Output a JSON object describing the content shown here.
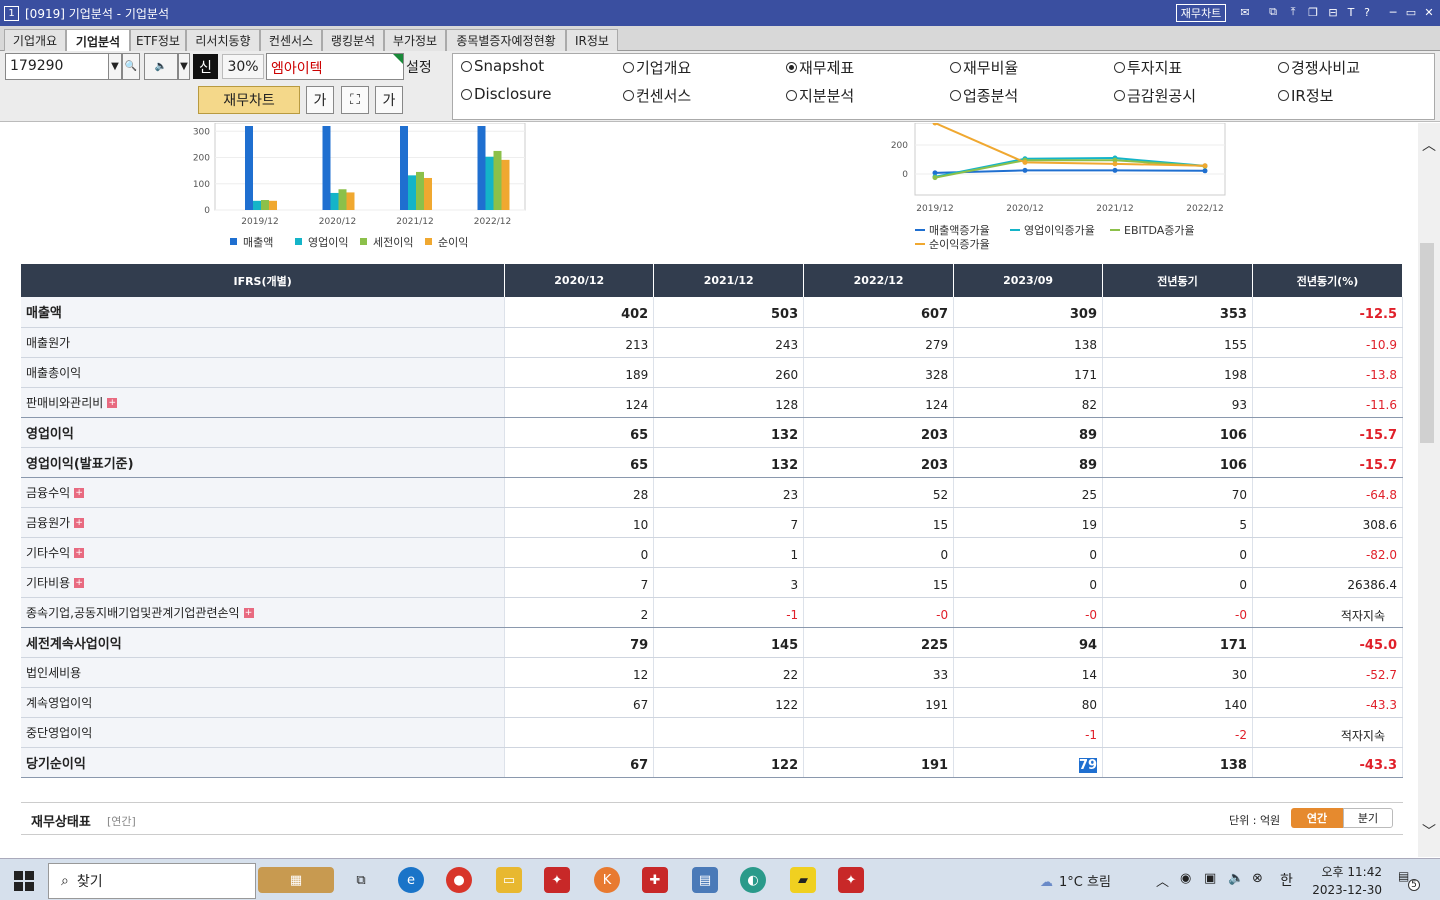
{
  "window": {
    "num": "1",
    "title": "[0919] 기업분석 - 기업분석",
    "fin_chart_btn": "재무차트"
  },
  "tabs": [
    "기업개요",
    "기업분석",
    "ETF정보",
    "리서치동향",
    "컨센서스",
    "랭킹분석",
    "부가정보",
    "종목별증자예정현황",
    "IR정보"
  ],
  "active_tab": "기업분석",
  "controls": {
    "code": "179290",
    "shin": "신",
    "percent": "30%",
    "company": "엠아이텍",
    "settings": "설정",
    "fin_chart": "재무차트",
    "font_btn": "가",
    "font_btn2": "가"
  },
  "radios": [
    {
      "label": "Snapshot",
      "checked": false
    },
    {
      "label": "기업개요",
      "checked": false
    },
    {
      "label": "재무제표",
      "checked": true
    },
    {
      "label": "재무비율",
      "checked": false
    },
    {
      "label": "투자지표",
      "checked": false
    },
    {
      "label": "경쟁사비교",
      "checked": false
    },
    {
      "label": "Disclosure",
      "checked": false
    },
    {
      "label": "컨센서스",
      "checked": false
    },
    {
      "label": "지분분석",
      "checked": false
    },
    {
      "label": "업종분석",
      "checked": false
    },
    {
      "label": "금감원공시",
      "checked": false
    },
    {
      "label": "IR정보",
      "checked": false
    }
  ],
  "chart_data": [
    {
      "type": "bar",
      "categories": [
        "2019/12",
        "2020/12",
        "2021/12",
        "2022/12"
      ],
      "ylim": [
        0,
        320
      ],
      "yticks": [
        "0",
        "100",
        "200",
        "300"
      ],
      "series": [
        {
          "name": "매출액",
          "color": "#1f6fd0",
          "values": [
            320,
            320,
            320,
            320
          ]
        },
        {
          "name": "영업이익",
          "color": "#14b4c8",
          "values": [
            35,
            65,
            132,
            203
          ]
        },
        {
          "name": "세전이익",
          "color": "#8cc04a",
          "values": [
            38,
            79,
            145,
            225
          ]
        },
        {
          "name": "순이익",
          "color": "#f0a830",
          "values": [
            35,
            67,
            122,
            191
          ]
        }
      ]
    },
    {
      "type": "line",
      "categories": [
        "2019/12",
        "2020/12",
        "2021/12",
        "2022/12"
      ],
      "yticks": [
        "0",
        "200"
      ],
      "series": [
        {
          "name": "매출액증가율",
          "color": "#1f6fd0",
          "values": [
            8,
            25,
            25,
            22
          ]
        },
        {
          "name": "영업이익증가율",
          "color": "#14b4c8",
          "values": [
            -20,
            105,
            110,
            56
          ]
        },
        {
          "name": "EBITDA증가율",
          "color": "#8cc04a",
          "values": [
            -25,
            95,
            95,
            54
          ]
        },
        {
          "name": "순이익증가율",
          "color": "#f0a830",
          "values": [
            520,
            80,
            70,
            57
          ]
        }
      ]
    }
  ],
  "table": {
    "headers": [
      "IFRS(개별)",
      "2020/12",
      "2021/12",
      "2022/12",
      "2023/09",
      "전년동기",
      "전년동기(%)"
    ],
    "rows": [
      {
        "label": "매출액",
        "vals": [
          "402",
          "503",
          "607",
          "309",
          "353",
          "-12.5"
        ],
        "bold": true,
        "plus": false
      },
      {
        "label": "매출원가",
        "vals": [
          "213",
          "243",
          "279",
          "138",
          "155",
          "-10.9"
        ],
        "bold": false,
        "plus": false
      },
      {
        "label": "매출총이익",
        "vals": [
          "189",
          "260",
          "328",
          "171",
          "198",
          "-13.8"
        ],
        "bold": false,
        "plus": false
      },
      {
        "label": "판매비와관리비",
        "vals": [
          "124",
          "128",
          "124",
          "82",
          "93",
          "-11.6"
        ],
        "bold": false,
        "plus": true
      },
      {
        "label": "영업이익",
        "vals": [
          "65",
          "132",
          "203",
          "89",
          "106",
          "-15.7"
        ],
        "bold": true,
        "plus": false
      },
      {
        "label": "영업이익(발표기준)",
        "vals": [
          "65",
          "132",
          "203",
          "89",
          "106",
          "-15.7"
        ],
        "bold": true,
        "plus": false
      },
      {
        "label": "금융수익",
        "vals": [
          "28",
          "23",
          "52",
          "25",
          "70",
          "-64.8"
        ],
        "bold": false,
        "plus": true
      },
      {
        "label": "금융원가",
        "vals": [
          "10",
          "7",
          "15",
          "19",
          "5",
          "308.6"
        ],
        "bold": false,
        "plus": true
      },
      {
        "label": "기타수익",
        "vals": [
          "0",
          "1",
          "0",
          "0",
          "0",
          "-82.0"
        ],
        "bold": false,
        "plus": true
      },
      {
        "label": "기타비용",
        "vals": [
          "7",
          "3",
          "15",
          "0",
          "0",
          "26386.4"
        ],
        "bold": false,
        "plus": true
      },
      {
        "label": "종속기업,공동지배기업및관계기업관련손익",
        "vals": [
          "2",
          "-1",
          "-0",
          "-0",
          "-0",
          "적자지속"
        ],
        "bold": false,
        "plus": true
      },
      {
        "label": "세전계속사업이익",
        "vals": [
          "79",
          "145",
          "225",
          "94",
          "171",
          "-45.0"
        ],
        "bold": true,
        "plus": false
      },
      {
        "label": "법인세비용",
        "vals": [
          "12",
          "22",
          "33",
          "14",
          "30",
          "-52.7"
        ],
        "bold": false,
        "plus": false
      },
      {
        "label": "계속영업이익",
        "vals": [
          "67",
          "122",
          "191",
          "80",
          "140",
          "-43.3"
        ],
        "bold": false,
        "plus": false
      },
      {
        "label": "중단영업이익",
        "vals": [
          "",
          "",
          "",
          "-1",
          "-2",
          "적자지속"
        ],
        "bold": false,
        "plus": false
      },
      {
        "label": "당기순이익",
        "vals": [
          "67",
          "122",
          "191",
          "79",
          "138",
          "-43.3"
        ],
        "bold": true,
        "plus": false
      }
    ]
  },
  "balance_sheet": {
    "title": "재무상태표",
    "sub": "[연간]",
    "unit": "단위 : 억원",
    "annual": "연간",
    "quarter": "분기"
  },
  "taskbar": {
    "search": "찾기",
    "weather": "1°C  흐림",
    "ime": "한",
    "time": "오후 11:42",
    "date": "2023-12-30",
    "notif": "5"
  }
}
